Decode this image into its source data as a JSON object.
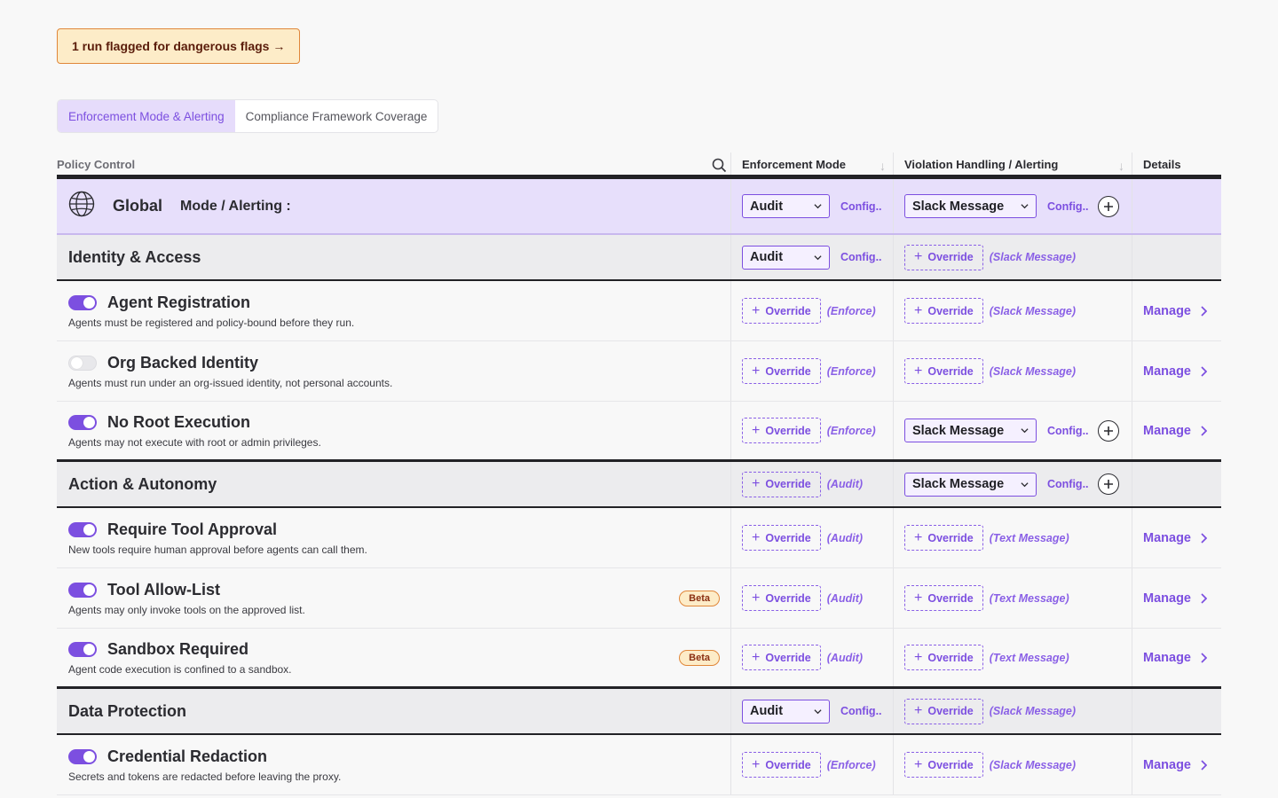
{
  "alert": {
    "text": "1 run flagged for dangerous flags →"
  },
  "tabs": [
    {
      "label": "Enforcement Mode & Alerting",
      "active": true
    },
    {
      "label": "Compliance Framework Coverage",
      "active": false
    }
  ],
  "columns": {
    "policy": "Policy Control",
    "enforcement": "Enforcement Mode",
    "violation": "Violation Handling / Alerting",
    "details": "Details",
    "sort_icon": "↓"
  },
  "global": {
    "title": "Global",
    "subtitle": "Mode / Alerting :",
    "mode": "Audit",
    "mode_config": "Config..",
    "alert": "Slack Message",
    "alert_config": "Config.."
  },
  "common": {
    "override": "Override",
    "manage": "Manage",
    "config": "Config..",
    "beta": "Beta",
    "plus": "+"
  },
  "groups": [
    {
      "title": "Identity & Access",
      "mode": "Audit",
      "mode_config": "Config..",
      "alert_inherit": "(Slack Message)",
      "policies": [
        {
          "title": "Agent Registration",
          "desc": "Agents must be registered and policy-bound before they run.",
          "enabled": true,
          "mode_inherit": "(Enforce)",
          "alert_inherit": "(Slack Message)"
        },
        {
          "title": "Org Backed Identity",
          "desc": "Agents must run under an org-issued identity, not personal accounts.",
          "enabled": false,
          "mode_inherit": "(Enforce)",
          "alert_inherit": "(Slack Message)"
        },
        {
          "title": "No Root Execution",
          "desc": "Agents may not execute with root or admin privileges.",
          "enabled": true,
          "mode_inherit": "(Enforce)",
          "alert": "Slack Message",
          "alert_config": "Config.."
        }
      ]
    },
    {
      "title": "Action & Autonomy",
      "mode_inherit": "(Audit)",
      "alert": "Slack Message",
      "alert_config": "Config..",
      "policies": [
        {
          "title": "Require Tool Approval",
          "desc": "New tools require human approval before agents can call them.",
          "enabled": true,
          "mode_inherit": "(Audit)",
          "alert_inherit": "(Text Message)"
        },
        {
          "title": "Tool Allow-List",
          "desc": "Agents may only invoke tools on the approved list.",
          "enabled": true,
          "beta": true,
          "mode_inherit": "(Audit)",
          "alert_inherit": "(Text Message)"
        },
        {
          "title": "Sandbox Required",
          "desc": "Agent code execution is confined to a sandbox.",
          "enabled": true,
          "beta": true,
          "mode_inherit": "(Audit)",
          "alert_inherit": "(Text Message)"
        }
      ]
    },
    {
      "title": "Data Protection",
      "mode": "Audit",
      "mode_config": "Config..",
      "alert_inherit": "(Slack Message)",
      "policies": [
        {
          "title": "Credential Redaction",
          "desc": "Secrets and tokens are redacted before leaving the proxy.",
          "enabled": true,
          "mode_inherit": "(Enforce)",
          "alert_inherit": "(Slack Message)"
        }
      ]
    }
  ],
  "colors": {
    "accent": "#7c4fe0",
    "global_bg": "#e7dffb",
    "group_bg": "#ececee",
    "alert_bg": "#fdecc8",
    "alert_border": "#e0873a"
  },
  "icons": {
    "search": "search-icon",
    "globe": "globe-icon",
    "chevron": "chevron-down-icon",
    "plus": "plus-icon",
    "manage": "chevron-right-icon"
  }
}
